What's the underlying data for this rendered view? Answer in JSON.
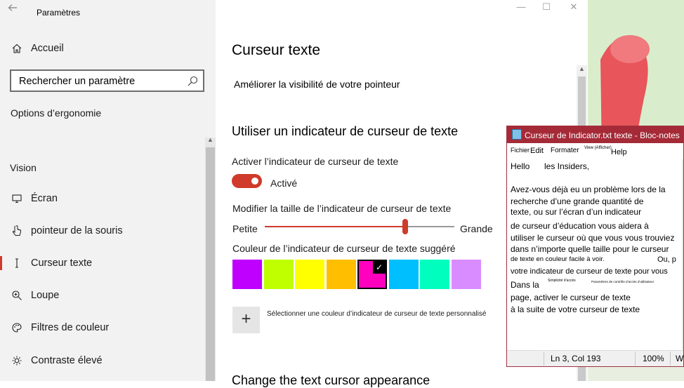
{
  "app": {
    "title": "Paramètres"
  },
  "sidebar": {
    "home": "Accueil",
    "search_placeholder": "Rechercher un paramètre",
    "section_ergonomics": "Options d’ergonomie",
    "section_vision": "Vision",
    "items": [
      {
        "label": "Écran",
        "icon": "monitor-icon"
      },
      {
        "label": "pointeur de la souris",
        "icon": "mouse-pointer-icon"
      },
      {
        "label": "Curseur texte",
        "icon": "text-cursor-icon",
        "selected": true
      },
      {
        "label": "Loupe",
        "icon": "magnifier-icon"
      },
      {
        "label": "Filtres de couleur",
        "icon": "palette-icon"
      },
      {
        "label": "Contraste élevé",
        "icon": "brightness-icon"
      }
    ]
  },
  "main": {
    "title": "Curseur texte",
    "subtitle": "Améliorer la visibilité de votre pointeur",
    "section_heading": "Utiliser un indicateur de curseur de texte",
    "toggle_label": "Activer l’indicateur de curseur de texte",
    "toggle_state": "Activé",
    "size_label": "Modifier la taille de l’indicateur de curseur de texte",
    "size_min": "Petite",
    "size_max": "Grande",
    "size_value_fraction": 0.74,
    "color_label": "Couleur de l’indicateur de curseur de texte suggéré",
    "swatches": [
      "#bf00ff",
      "#bfff00",
      "#ffff00",
      "#ffbf00",
      "#ff00bf",
      "#00bfff",
      "#00ffbf",
      "#d98cff"
    ],
    "selected_swatch": 4,
    "custom_color_label": "Sélectionner une couleur d’indicateur de curseur de texte personnalisé",
    "next_heading": "Change the text cursor appearance"
  },
  "notepad": {
    "title": "Curseur de Indicator.txt texte - Bloc-notes",
    "menu": {
      "file": "Fichier",
      "edit": "Edit",
      "format": "Formater",
      "view": "View (Afficher)",
      "help": "Help"
    },
    "lines": {
      "l1a": "Hello",
      "l1b": "les Insiders,",
      "l2": "Avez-vous déjà eu un problème lors de la",
      "l3": "recherche d’une grande quantité de",
      "l4": "texte, ou sur l’écran d’un indicateur",
      "l5": "de curseur d’éducation vous aidera à",
      "l6": "utiliser le curseur où que vous vous trouviez",
      "l7": "dans n’importe quelle taille pour le curseur",
      "l8a": "de texte en couleur facile à voir.",
      "l8b": "Ou, p",
      "l9": "votre indicateur de curseur de texte pour vous",
      "l10a": "Dans la",
      "l10b": "Simplicité d’accès",
      "l10c": "Paramètres de contrôle d’accès d’utilisateur",
      "l11": "page, activer le curseur de texte",
      "l12": "à la suite de votre curseur de texte"
    },
    "status": {
      "position": "Ln 3, Col 193",
      "zoom": "100%",
      "encoding": "W"
    }
  },
  "colors": {
    "accent": "#cf3a2a",
    "sidebar_bg": "#f2f2f2",
    "notepad_title": "#a52a37"
  }
}
